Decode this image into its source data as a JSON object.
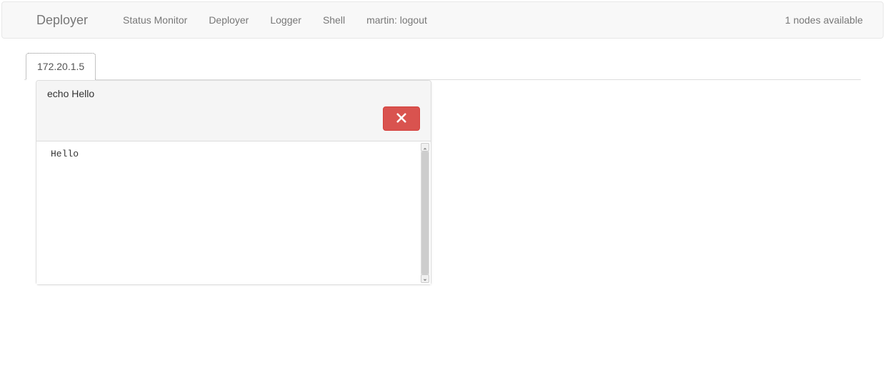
{
  "navbar": {
    "brand": "Deployer",
    "items": [
      {
        "label": "Status Monitor"
      },
      {
        "label": "Deployer"
      },
      {
        "label": "Logger"
      },
      {
        "label": "Shell"
      },
      {
        "label": "martin: logout"
      }
    ],
    "status": "1 nodes available"
  },
  "tabs": [
    {
      "label": "172.20.1.5",
      "active": true
    }
  ],
  "panel": {
    "command": "echo Hello",
    "output": "Hello"
  }
}
